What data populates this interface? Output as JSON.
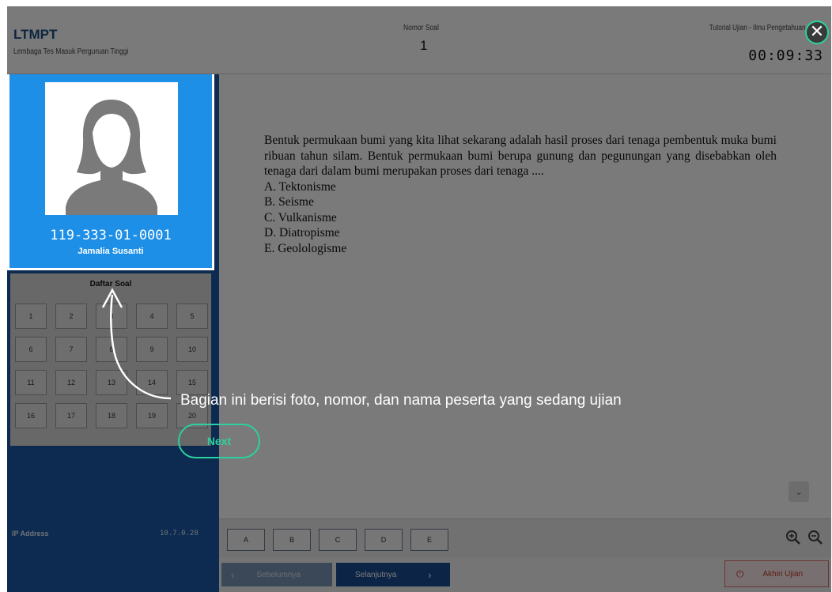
{
  "header": {
    "brand": "LTMPT",
    "brand_sub": "Lembaga Tes Masuk Perguruan Tinggi",
    "question_number_label": "Nomor Soal",
    "question_number": "1",
    "tutorial_label": "Tutorial Ujian - Ilmu Pengetahuan",
    "timer": "00:09:33"
  },
  "participant": {
    "id": "119-333-01-0001",
    "name": "Jamalia Susanti",
    "photo_icon": "user-avatar-icon"
  },
  "question_list": {
    "title": "Daftar Soal",
    "numbers": [
      "1",
      "2",
      "3",
      "4",
      "5",
      "6",
      "7",
      "8",
      "9",
      "10",
      "11",
      "12",
      "13",
      "14",
      "15",
      "16",
      "17",
      "18",
      "19",
      "20"
    ]
  },
  "network": {
    "ip_label": "IP Address",
    "ip_value": "10.7.0.28"
  },
  "question": {
    "text": "Bentuk permukaan bumi yang kita lihat sekarang adalah hasil proses dari tenaga pembentuk muka bumi ribuan tahun silam. Bentuk permukaan bumi berupa gunung dan pegunungan yang disebabkan oleh tenaga dari dalam bumi merupakan proses dari tenaga ....",
    "options": [
      "A. Tektonisme",
      "B. Seisme",
      "C. Vulkanisme",
      "D. Diatropisme",
      "E. Geolologisme"
    ]
  },
  "answers": [
    "A",
    "B",
    "C",
    "D",
    "E"
  ],
  "navigation": {
    "prev_label": "Sebelumnya",
    "next_label": "Selanjutnya",
    "end_label": "Akhiri Ujian"
  },
  "tutorial": {
    "callout": "Bagian ini berisi foto, nomor, dan nama peserta yang sedang ujian",
    "next_label": "Next",
    "close_icon": "close-icon",
    "accent_color": "#2bd1a0"
  },
  "colors": {
    "profile_bg": "#1e8fe6",
    "sidebar_bg": "#1d5aa8",
    "brand": "#1f4e85",
    "next_button": "#1b4f93",
    "end_button": "#c0392b"
  }
}
